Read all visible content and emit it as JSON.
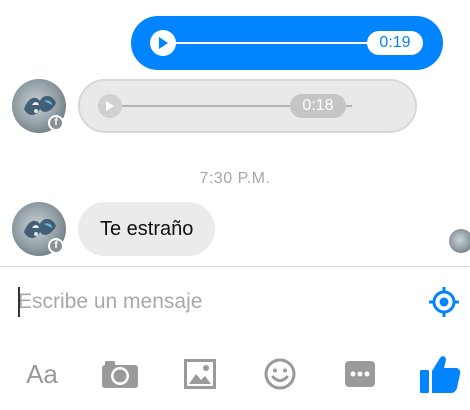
{
  "messages": {
    "outgoing_audio": {
      "duration": "0:19",
      "play_icon": "play-icon"
    },
    "incoming_audio": {
      "duration": "0:18",
      "play_icon": "play-icon"
    },
    "timestamp": "7:30 P.M.",
    "incoming_text": "Te estraño"
  },
  "composer": {
    "placeholder": "Escribe un mensaje",
    "value": "",
    "location_icon": "location-crosshair-icon"
  },
  "toolbar": {
    "text_label": "Aa",
    "items": [
      "camera-icon",
      "gallery-icon",
      "emoji-icon",
      "more-icon",
      "like-thumb-icon"
    ]
  },
  "colors": {
    "accent": "#0084ff",
    "icon_gray": "#9a9a9a",
    "incoming_bubble": "#ebebeb"
  }
}
